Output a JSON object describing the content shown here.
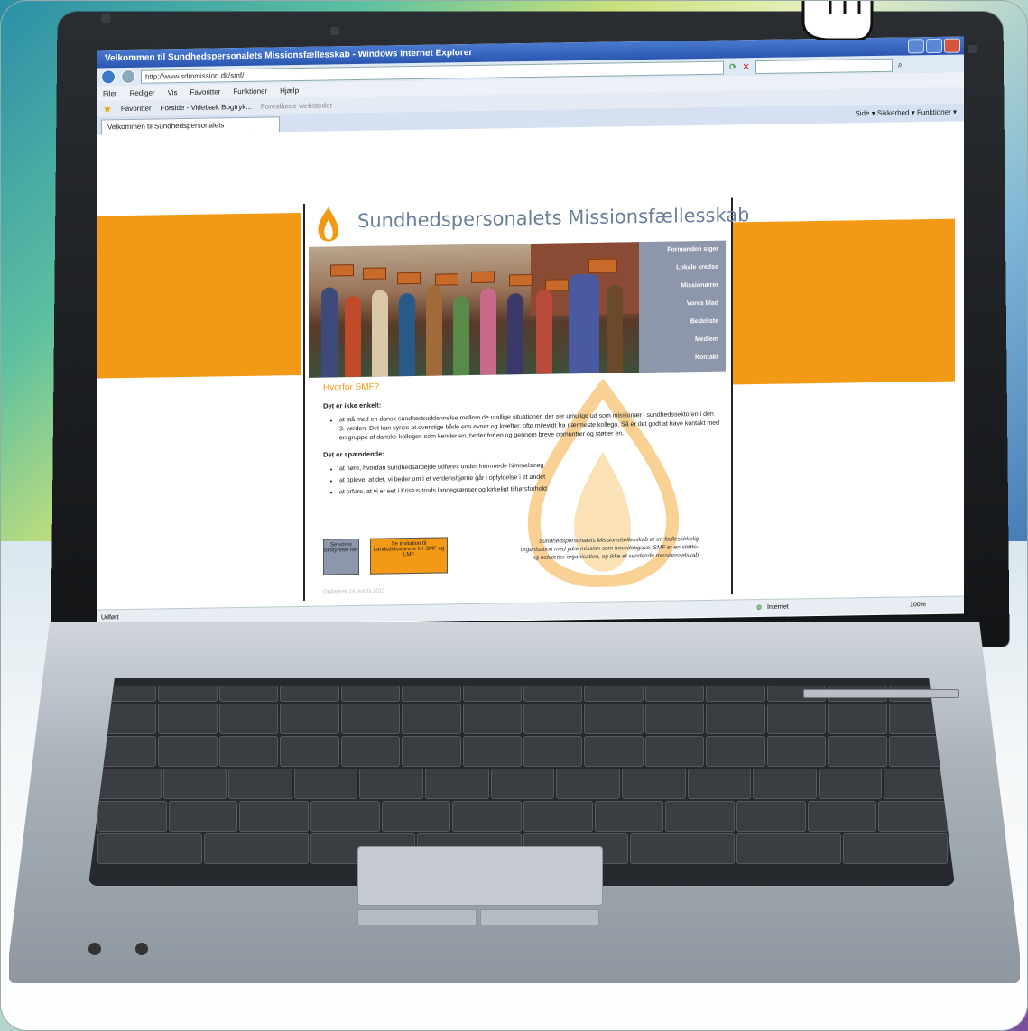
{
  "browser": {
    "window_title": "Velkommen til Sundhedspersonalets Missionsfællesskab - Windows Internet Explorer",
    "address": "http://www.sdmmission.dk/smf/",
    "menu": [
      "Filer",
      "Rediger",
      "Vis",
      "Favoritter",
      "Funktioner",
      "Hjælp"
    ],
    "favorites_label": "Favoritter",
    "favorites_links": [
      "Forside - Videbæk Bogtryk...",
      "Foreslåede websteder"
    ],
    "tab_label": "Velkommen til Sundhedspersonalets Missionsfællesskab",
    "tools": "Side ▾  Sikkerhed ▾  Funktioner ▾",
    "status_left": "Udført",
    "status_zone": "Internet",
    "zoom": "100%"
  },
  "site": {
    "title": "Sundhedspersonalets Missionsfællesskab",
    "nav": [
      "Formanden siger",
      "Lokale kredse",
      "Missionærer",
      "Vores blad",
      "Bedeliste",
      "Medlem",
      "Kontakt"
    ],
    "heading": "Hvorfor SMF?",
    "section1_title": "Det er ikke enkelt:",
    "section1_items": [
      "at stå med en dansk sundhedsuddannelse mellem de utallige situationer, der ser umulige ud som missionær i sundhedssektoren i den 3. verden. Det kan synes at overstige både ens evner og kræfter, ofte milevidt fra nærmeste kollega. Så er det godt at have kontakt med en gruppe af danske kolleger, som kender en, beder for en og gennem breve opmuntrer og støtter en."
    ],
    "section2_title": "Det er spændende:",
    "section2_items": [
      "at høre, hvordan sundhedsarbejde udføres under fremmede himmelstrøg",
      "at opleve, at det, vi beder om i et verdenshjørne går i opfyldelse i et andet",
      "at erfare, at vi er eet i Kristus trods landegrænser og kirkeligt tilhørsforhold"
    ],
    "btn_board": "Se vores bestyrelse her",
    "btn_invite": "Se invitation til Landsdelsstævne for SMF og LMF",
    "about": "Sundhedspersonalets Missionsfællesskab er en fælleskirkelig organisation med ydre mission som hovedopgave. SMF er en støtte- og netværks-organisation, og ikke et sendende missionsselskab",
    "updated": "Opdateret 14. marts 2013"
  },
  "colors": {
    "accent": "#f29a16",
    "nav_bg": "#8d97ab",
    "title": "#6a7f98"
  }
}
